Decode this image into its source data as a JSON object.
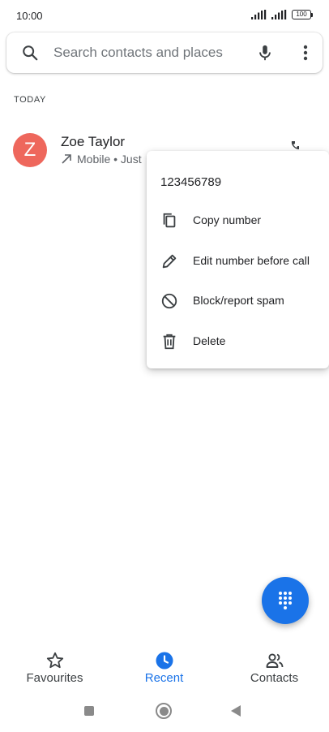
{
  "status_bar": {
    "time": "10:00",
    "battery": "100"
  },
  "search": {
    "placeholder": "Search contacts and places",
    "icon": "search-icon",
    "mic_icon": "mic-icon",
    "more_icon": "more-vert-icon"
  },
  "recent": {
    "section_label": "TODAY",
    "call": {
      "avatar_letter": "Z",
      "avatar_color": "#ee675c",
      "name": "Zoe Taylor",
      "meta": "Mobile • Just"
    }
  },
  "popup_menu": {
    "number": "123456789",
    "items": [
      {
        "label": "Copy number",
        "icon": "copy-icon"
      },
      {
        "label": "Edit number before call",
        "icon": "edit-icon"
      },
      {
        "label": "Block/report spam",
        "icon": "block-icon"
      },
      {
        "label": "Delete",
        "icon": "delete-icon"
      }
    ]
  },
  "fab": {
    "icon": "dialpad-icon",
    "color": "#1a73e8"
  },
  "bottom_nav": {
    "active": "Recent",
    "accent": "#1a73e8",
    "items": [
      {
        "label": "Favourites",
        "icon": "star-icon"
      },
      {
        "label": "Recent",
        "icon": "clock-icon"
      },
      {
        "label": "Contacts",
        "icon": "people-icon"
      }
    ]
  },
  "system_nav": {
    "recents": "square-icon",
    "home": "circle-icon",
    "back": "back-triangle-icon"
  }
}
